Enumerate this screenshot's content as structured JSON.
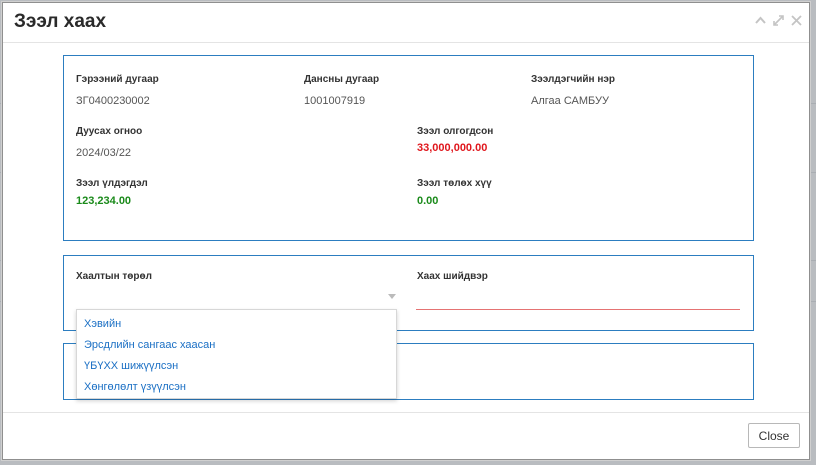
{
  "dialog": {
    "title": "Зээл хаах",
    "close_label": "Close"
  },
  "loan_info": {
    "contract_number_label": "Гэрээний дугаар",
    "contract_number": "ЗГ0400230002",
    "account_number_label": "Дансны дугаар",
    "account_number": "1001007919",
    "borrower_name_label": "Зээлдэгчийн нэр",
    "borrower_name": "Алгаа САМБУУ",
    "end_date_label": "Дуусах огноо",
    "end_date": "2024/03/22",
    "loan_disbursed_label": "Зээл олгогдсон",
    "loan_disbursed": "33,000,000.00",
    "loan_balance_label": "Зээл үлдэгдэл",
    "loan_balance": "123,234.00",
    "interest_due_label": "Зээл төлөх хүү",
    "interest_due": "0.00"
  },
  "closing": {
    "closing_type_label": "Хаалтын төрөл",
    "closing_decision_label": "Хаах шийдвэр",
    "closing_decision_value": "",
    "options": [
      "Хэвийн",
      "Эрсдлийн сангаас хаасан",
      "ҮБҮХХ шижүүлсэн",
      "Хөнгөлөлт үзүүлсэн"
    ]
  },
  "colors": {
    "accent": "#2c7dc0",
    "disbursed": "#e0171d",
    "balance": "#1a8a1a",
    "option_text": "#1a6fc4"
  },
  "icons": {
    "minimize": "chevron-up-icon",
    "maximize": "expand-icon",
    "close": "close-icon",
    "dropdown": "caret-down-icon"
  }
}
